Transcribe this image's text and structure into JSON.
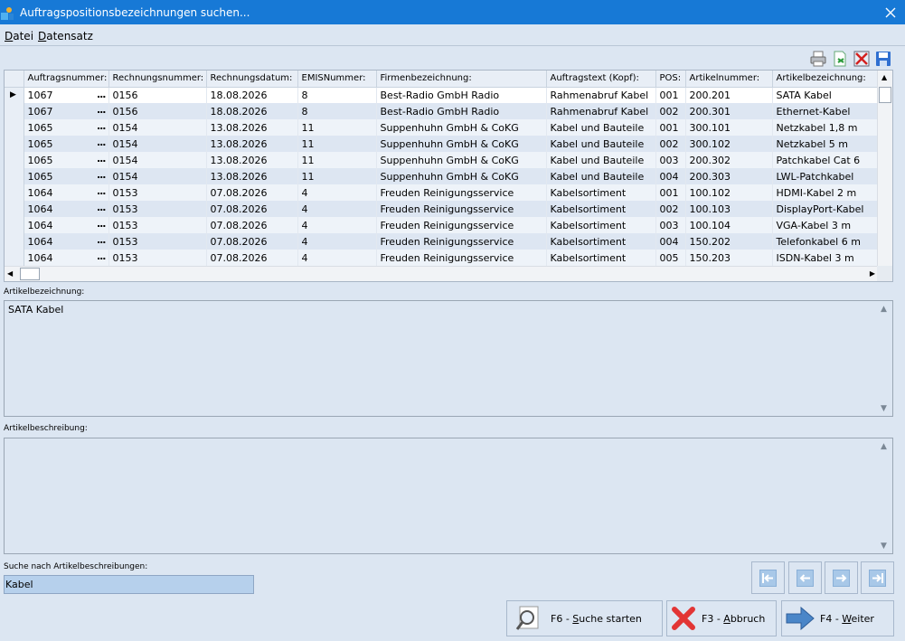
{
  "window": {
    "title": "Auftragspositionsbezeichnungen suchen..."
  },
  "menu": [
    "Datei",
    "Datensatz"
  ],
  "toolbar": {
    "icons": [
      "printer-icon",
      "export-icon",
      "delete-icon",
      "save-icon"
    ]
  },
  "grid": {
    "columns": [
      "Auftragsnummer:",
      "Rechnungsnummer:",
      "Rechnungsdatum:",
      "EMISNummer:",
      "Firmenbezeichnung:",
      "Auftragstext (Kopf):",
      "POS:",
      "Artikelnummer:",
      "Artikelbezeichnung:"
    ],
    "dots": "...",
    "rows": [
      [
        "1067",
        "0156",
        "18.08.2026",
        "8",
        "Best-Radio GmbH Radio",
        "Rahmenabruf Kabel",
        "001",
        "200.201",
        "SATA Kabel"
      ],
      [
        "1067",
        "0156",
        "18.08.2026",
        "8",
        "Best-Radio GmbH Radio",
        "Rahmenabruf Kabel",
        "002",
        "200.301",
        "Ethernet-Kabel"
      ],
      [
        "1065",
        "0154",
        "13.08.2026",
        "11",
        "Suppenhuhn GmbH & CoKG",
        "Kabel und Bauteile",
        "001",
        "300.101",
        "Netzkabel 1,8 m"
      ],
      [
        "1065",
        "0154",
        "13.08.2026",
        "11",
        "Suppenhuhn GmbH & CoKG",
        "Kabel und Bauteile",
        "002",
        "300.102",
        "Netzkabel 5 m"
      ],
      [
        "1065",
        "0154",
        "13.08.2026",
        "11",
        "Suppenhuhn GmbH & CoKG",
        "Kabel und Bauteile",
        "003",
        "200.302",
        "Patchkabel Cat 6"
      ],
      [
        "1065",
        "0154",
        "13.08.2026",
        "11",
        "Suppenhuhn GmbH & CoKG",
        "Kabel und Bauteile",
        "004",
        "200.303",
        "LWL-Patchkabel"
      ],
      [
        "1064",
        "0153",
        "07.08.2026",
        "4",
        "Freuden Reinigungsservice",
        "Kabelsortiment",
        "001",
        "100.102",
        "HDMI-Kabel 2 m"
      ],
      [
        "1064",
        "0153",
        "07.08.2026",
        "4",
        "Freuden Reinigungsservice",
        "Kabelsortiment",
        "002",
        "100.103",
        "DisplayPort-Kabel"
      ],
      [
        "1064",
        "0153",
        "07.08.2026",
        "4",
        "Freuden Reinigungsservice",
        "Kabelsortiment",
        "003",
        "100.104",
        "VGA-Kabel 3 m"
      ],
      [
        "1064",
        "0153",
        "07.08.2026",
        "4",
        "Freuden Reinigungsservice",
        "Kabelsortiment",
        "004",
        "150.202",
        "Telefonkabel 6 m"
      ],
      [
        "1064",
        "0153",
        "07.08.2026",
        "4",
        "Freuden Reinigungsservice",
        "Kabelsortiment",
        "005",
        "150.203",
        "ISDN-Kabel 3 m"
      ]
    ]
  },
  "artikelbezeichnung": {
    "label": "Artikelbezeichnung:",
    "value": "SATA Kabel"
  },
  "artikelbeschreibung": {
    "label": "Artikelbeschreibung:",
    "value": ""
  },
  "search": {
    "label": "Suche nach Artikelbeschreibungen:",
    "value": "Kabel"
  },
  "buttons": {
    "search": {
      "key": "F6 - ",
      "accel": "S",
      "rest": "uche starten"
    },
    "cancel": {
      "key": "F3 - ",
      "accel": "A",
      "rest": "bbruch"
    },
    "next": {
      "key": "F4 - ",
      "accel": "W",
      "rest": "eiter"
    }
  },
  "colors": {
    "titlebar": "#1779d6",
    "background": "#dce6f2",
    "search_field": "#b6d0ec"
  }
}
